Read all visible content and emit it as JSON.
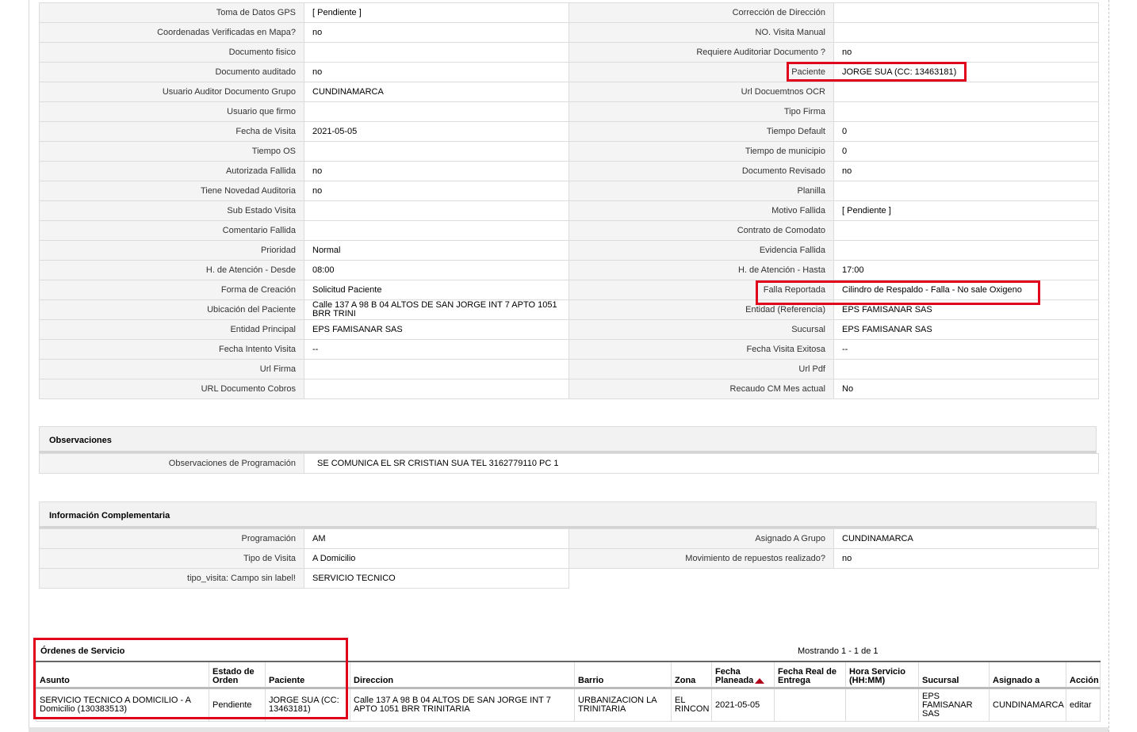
{
  "details": [
    [
      "Toma de Datos GPS",
      "[ Pendiente ]",
      "Corrección de Dirección",
      ""
    ],
    [
      "Coordenadas Verificadas en Mapa?",
      "no",
      "NO. Visita Manual",
      ""
    ],
    [
      "Documento fisico",
      "",
      "Requiere Auditoriar Documento ?",
      "no"
    ],
    [
      "Documento auditado",
      "no",
      "Paciente",
      "JORGE SUA (CC: 13463181)"
    ],
    [
      "Usuario Auditor Documento Grupo",
      "CUNDINAMARCA",
      "Url Docuemtnos OCR",
      ""
    ],
    [
      "Usuario que firmo",
      "",
      "Tipo Firma",
      ""
    ],
    [
      "Fecha de Visita",
      "2021-05-05",
      "Tiempo Default",
      "0"
    ],
    [
      "Tiempo OS",
      "",
      "Tiempo de municipio",
      "0"
    ],
    [
      "Autorizada Fallida",
      "no",
      "Documento Revisado",
      "no"
    ],
    [
      "Tiene Novedad Auditoria",
      "no",
      "Planilla",
      ""
    ],
    [
      "Sub Estado Visita",
      "",
      "Motivo Fallida",
      "[ Pendiente ]"
    ],
    [
      "Comentario Fallida",
      "",
      "Contrato de Comodato",
      ""
    ],
    [
      "Prioridad",
      "Normal",
      "Evidencia Fallida",
      ""
    ],
    [
      "H. de Atención - Desde",
      "08:00",
      "H. de Atención - Hasta",
      "17:00"
    ],
    [
      "Forma de Creación",
      "Solicitud Paciente",
      "Falla Reportada",
      "Cilindro de Respaldo - Falla - No sale Oxigeno"
    ],
    [
      "Ubicación del Paciente",
      "Calle 137 A 98 B 04 ALTOS DE SAN JORGE INT 7 APTO 1051 BRR TRINI",
      "Entidad (Referencia)",
      "EPS FAMISANAR SAS"
    ],
    [
      "Entidad Principal",
      "EPS FAMISANAR SAS",
      "Sucursal",
      "EPS FAMISANAR SAS"
    ],
    [
      "Fecha Intento Visita",
      "--",
      "Fecha Visita Exitosa",
      "--"
    ],
    [
      "Url Firma",
      "",
      "Url Pdf",
      ""
    ],
    [
      "URL Documento Cobros",
      "",
      "Recaudo CM Mes actual",
      "No"
    ]
  ],
  "observaciones": {
    "title": "Observaciones",
    "label": "Observaciones de Programación",
    "value": "SE COMUNICA EL SR CRISTIAN SUA TEL 3162779110 PC 1"
  },
  "complementaria": {
    "title": "Información Complementaria",
    "rows": [
      [
        "Programación",
        "AM",
        "Asignado A Grupo",
        "CUNDINAMARCA"
      ],
      [
        "Tipo de Visita",
        "A Domicilio",
        "Movimiento de repuestos realizado?",
        "no"
      ],
      [
        "tipo_visita: Campo sin label!",
        "SERVICIO TECNICO",
        "",
        ""
      ]
    ]
  },
  "orders": {
    "title": "Órdenes de Servicio",
    "showing": "Mostrando 1 - 1 de 1",
    "headers": [
      "Asunto",
      "Estado de Orden",
      "Paciente",
      "Direccion",
      "Barrio",
      "Zona",
      "Fecha Planeada",
      "Fecha Real de Entrega",
      "Hora Servicio (HH:MM)",
      "Sucursal",
      "Asignado a",
      "Acción"
    ],
    "rows": [
      [
        "SERVICIO TECNICO A DOMICILIO - A Domicilio (130383513)",
        "Pendiente",
        "JORGE SUA (CC: 13463181)",
        "Calle 137 A 98 B 04 ALTOS DE SAN JORGE INT 7 APTO 1051 BRR TRINITARIA",
        "URBANIZACION LA TRINITARIA",
        "EL RINCON",
        "2021-05-05",
        "",
        "",
        "EPS FAMISANAR SAS",
        "CUNDINAMARCA",
        "editar"
      ]
    ]
  },
  "colors": {
    "highlight": "#e0001b",
    "label_bg": "#f4f4f4",
    "border": "#dcdcdc"
  }
}
